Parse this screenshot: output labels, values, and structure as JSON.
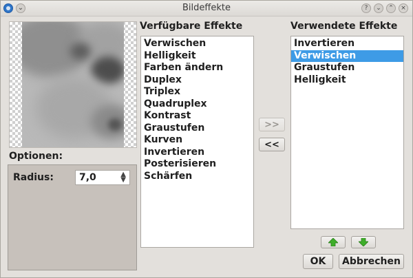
{
  "window": {
    "title": "Bildeffekte"
  },
  "titlebar_buttons": [
    "?",
    "⌄",
    "⌃",
    "×"
  ],
  "options": {
    "title": "Optionen:",
    "radius_label": "Radius:",
    "radius_value": "7,0"
  },
  "available": {
    "title": "Verfügbare Effekte",
    "items": [
      "Verwischen",
      "Helligkeit",
      "Farben ändern",
      "Duplex",
      "Triplex",
      "Quadruplex",
      "Kontrast",
      "Graustufen",
      "Kurven",
      "Invertieren",
      "Posterisieren",
      "Schärfen"
    ]
  },
  "used": {
    "title": "Verwendete Effekte",
    "items": [
      "Invertieren",
      "Verwischen",
      "Graustufen",
      "Helligkeit"
    ],
    "selected_index": 1
  },
  "buttons": {
    "add": ">>",
    "remove": "<<",
    "ok": "OK",
    "cancel": "Abbrechen"
  },
  "colors": {
    "selection": "#3e9be6",
    "arrow_green": "#3fae2a"
  }
}
